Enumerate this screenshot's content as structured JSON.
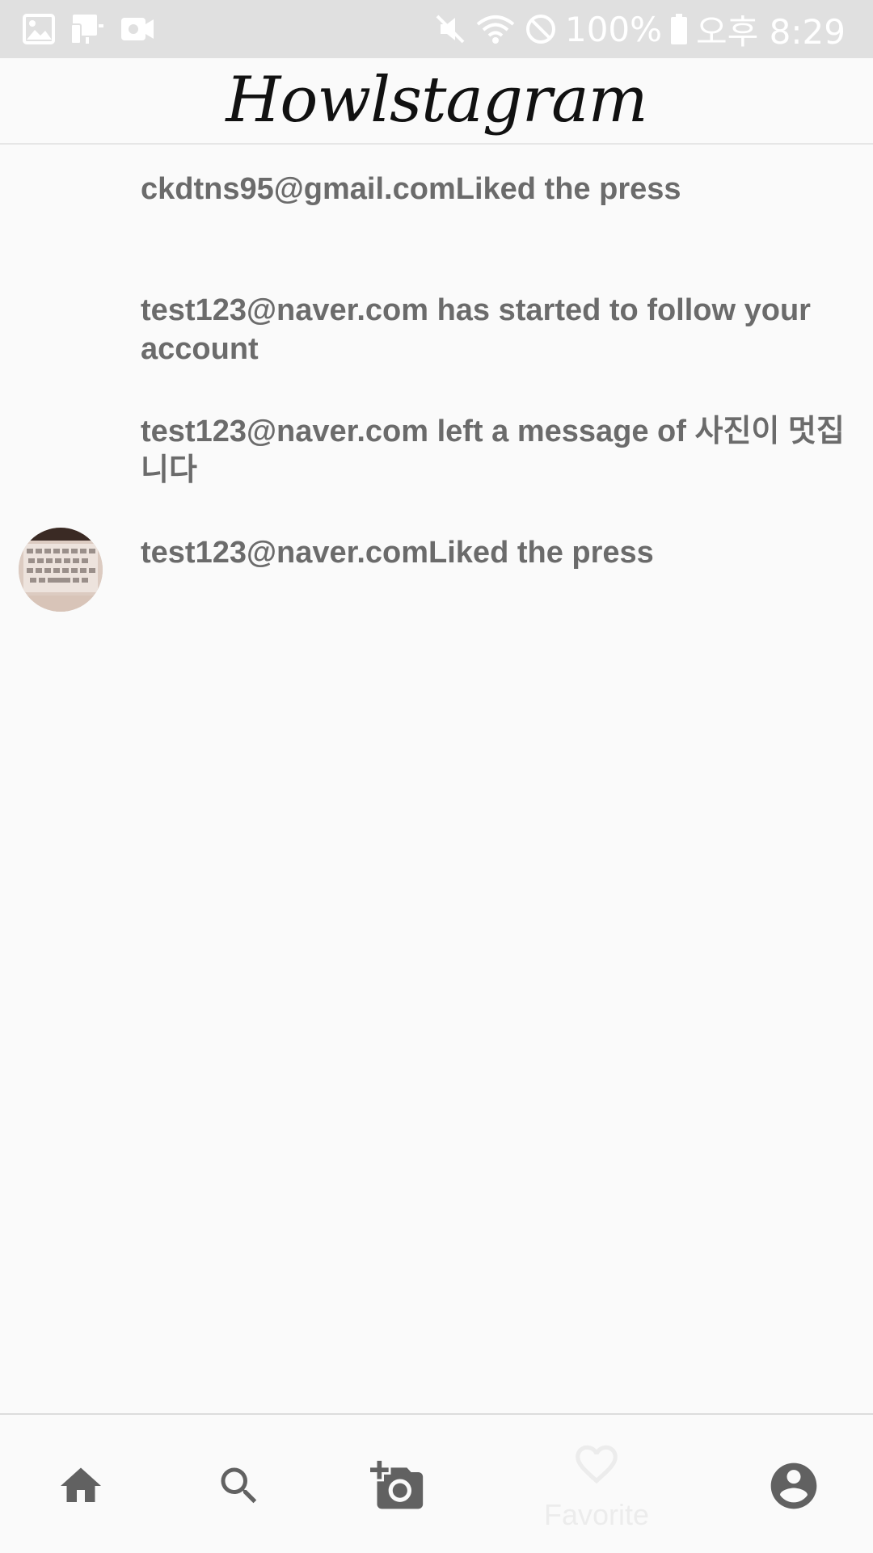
{
  "status_bar": {
    "battery": "100%",
    "time": "오후 8:29",
    "icons": [
      "gallery-icon",
      "screen-mirror-icon",
      "video-icon",
      "mute-icon",
      "wifi-icon",
      "do-not-disturb-icon",
      "battery-icon"
    ]
  },
  "header": {
    "title": "Howlstagram"
  },
  "notifications": [
    {
      "text": "ckdtns95@gmail.comLiked the press",
      "has_avatar": false
    },
    {
      "text": "test123@naver.com has started to follow your account",
      "has_avatar": false
    },
    {
      "text": "test123@naver.com left a message of 사진이 멋집니다",
      "has_avatar": false
    },
    {
      "text": "test123@naver.comLiked the press",
      "has_avatar": true
    }
  ],
  "bottom_nav": {
    "items": [
      {
        "icon": "home-icon"
      },
      {
        "icon": "search-icon"
      },
      {
        "icon": "add-photo-icon"
      },
      {
        "icon": "favorite-icon",
        "label": "Favorite",
        "selected": true
      },
      {
        "icon": "account-icon"
      }
    ]
  },
  "colors": {
    "background": "#fafafa",
    "status_bar": "#e0e0e0",
    "text": "#6b6b6b",
    "nav_icon": "#616161",
    "favorite_faded": "#ececec"
  }
}
